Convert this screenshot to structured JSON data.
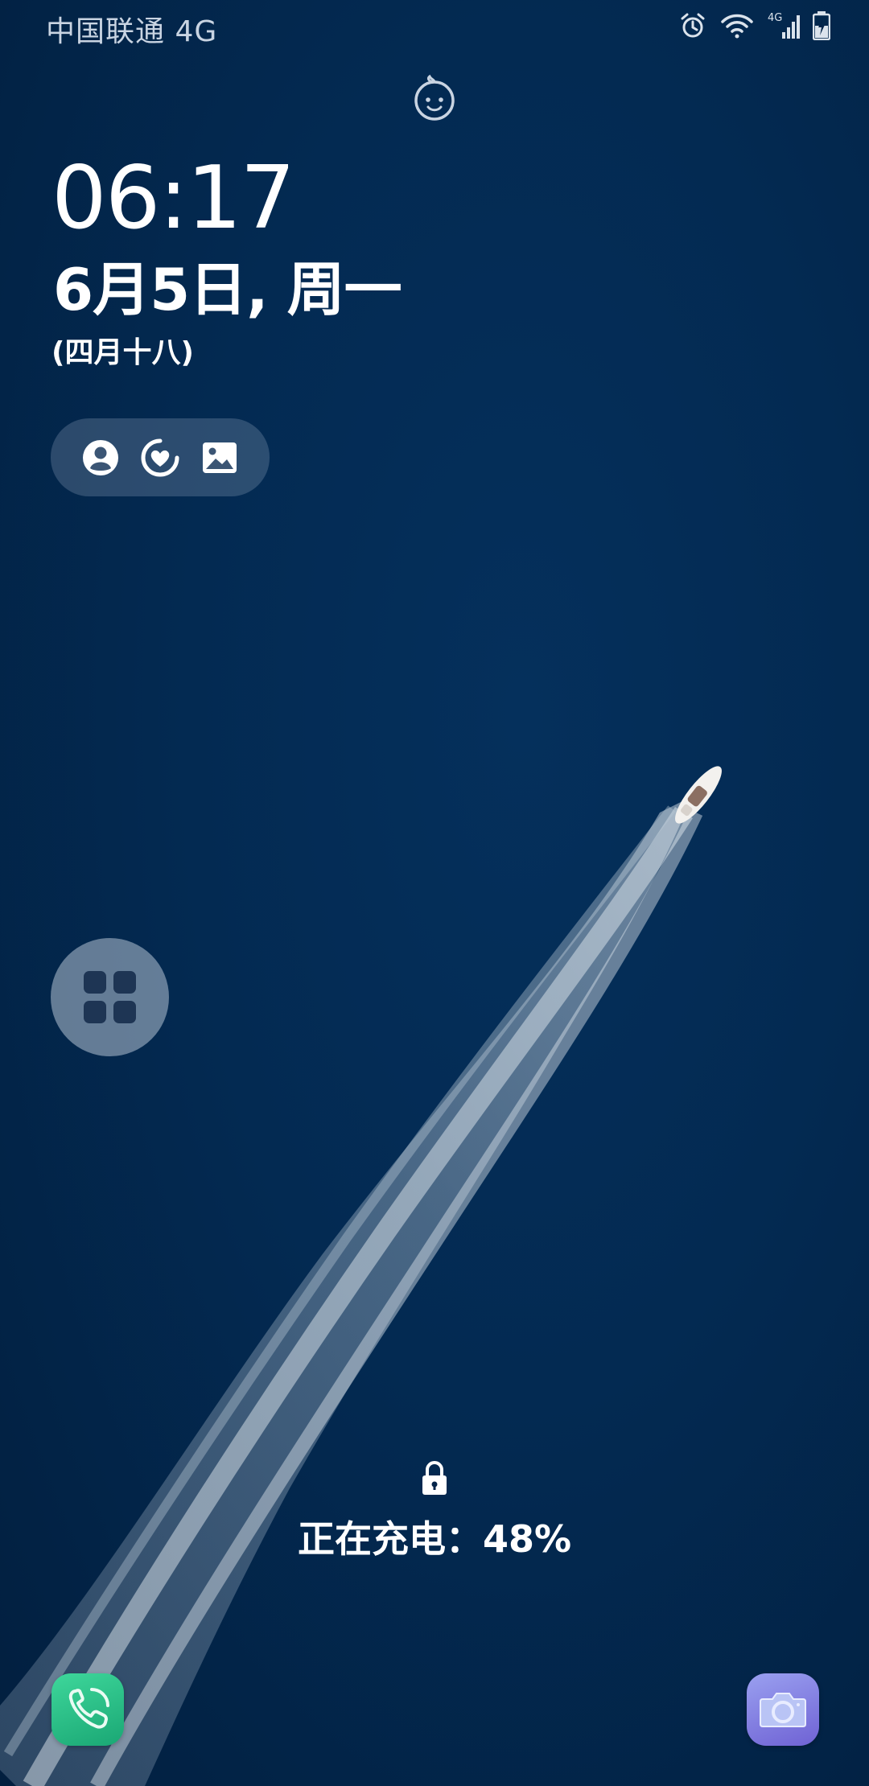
{
  "status_bar": {
    "carrier": "中国联通 4G",
    "network_label": "4G",
    "icons": [
      "alarm-icon",
      "wifi-icon",
      "signal-icon",
      "battery-charging-icon"
    ]
  },
  "lock_screen": {
    "time": "06:17",
    "date": "6月5日, 周一",
    "lunar_date": "(四月十八)",
    "shortcut_icons": [
      "person-icon",
      "heart-icon",
      "gallery-icon"
    ],
    "charging_text": "正在充电：48%",
    "battery_percent": 48
  },
  "shortcuts": {
    "left": "phone-icon",
    "right": "camera-icon"
  },
  "colors": {
    "background": "#03244a",
    "phone": "#2cc487",
    "camera": "#8581e6"
  }
}
